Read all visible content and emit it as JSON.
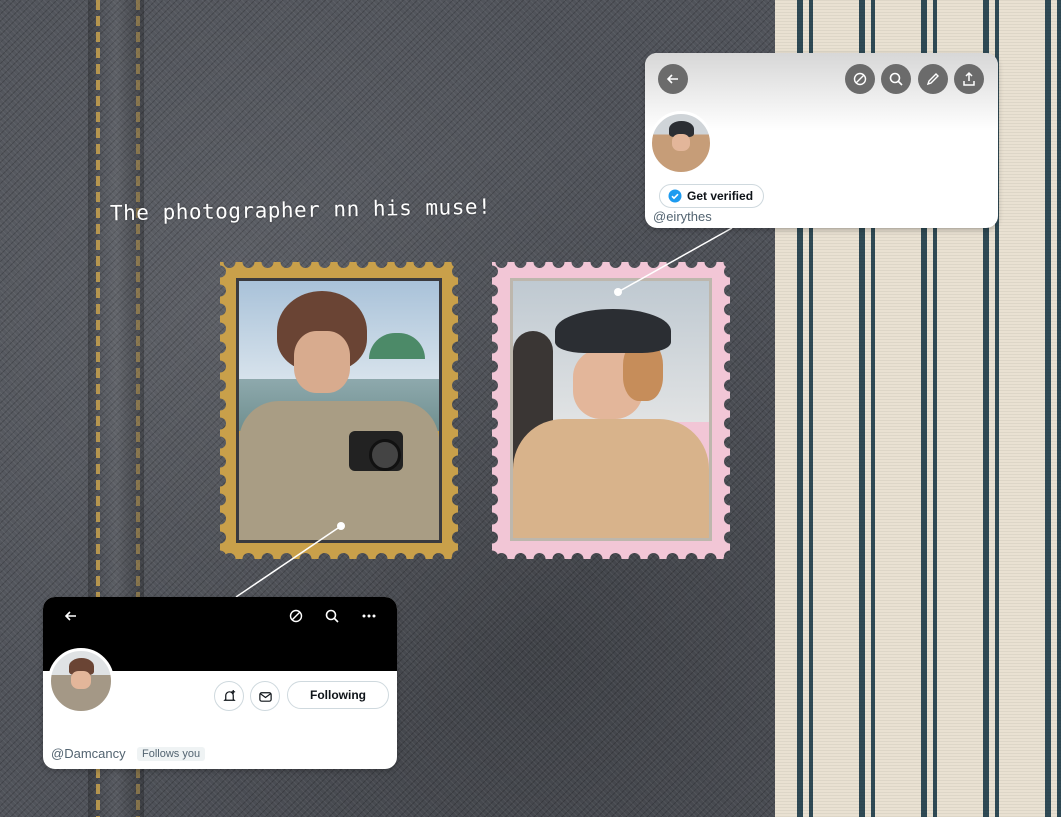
{
  "caption": "The photographer nn his muse!",
  "top_profile": {
    "verify_label": "Get verified",
    "handle": "@eirythes",
    "icons": [
      "back-arrow-icon",
      "history-icon",
      "search-icon",
      "edit-pencil-icon",
      "share-icon"
    ]
  },
  "bottom_profile": {
    "handle": "@Damcancy",
    "follows_you": "Follows you",
    "following_label": "Following",
    "icons": [
      "back-arrow-icon",
      "history-icon",
      "search-icon",
      "more-icon",
      "notification-add-icon",
      "message-icon"
    ]
  },
  "colors": {
    "left_stamp": "#c9a04a",
    "right_stamp": "#f2c6d6",
    "verify_blue": "#1d9bf0"
  }
}
